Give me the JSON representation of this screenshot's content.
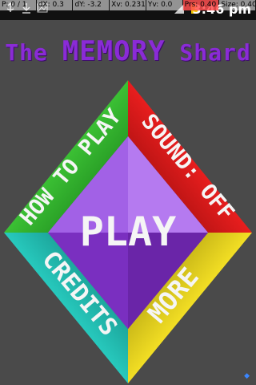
{
  "debug": {
    "p": "P: 0 / 1",
    "dx": "dX: 0.3",
    "dy": "dY: -3.2",
    "xv": "Xv: 0.231",
    "yv": "Yv: 0.0",
    "prs": "Prs: 0.40",
    "size": "Size: 0.40"
  },
  "status": {
    "time": "3:46 pm"
  },
  "title": {
    "pre": "The ",
    "main": "MEMORY",
    "post": " Shard"
  },
  "menu": {
    "play": "PLAY",
    "how_to_play": "HOW TO PLAY",
    "sound": "SOUND: OFF",
    "credits": "CREDITS",
    "more": "MORE"
  },
  "colors": {
    "background": "#4a4a4a",
    "title": "#8a2bd6",
    "how_to_play": "#2fa12a",
    "sound": "#cc1414",
    "credits": "#1aa39a",
    "more": "#d4c014",
    "play": "#9b4fd9"
  }
}
